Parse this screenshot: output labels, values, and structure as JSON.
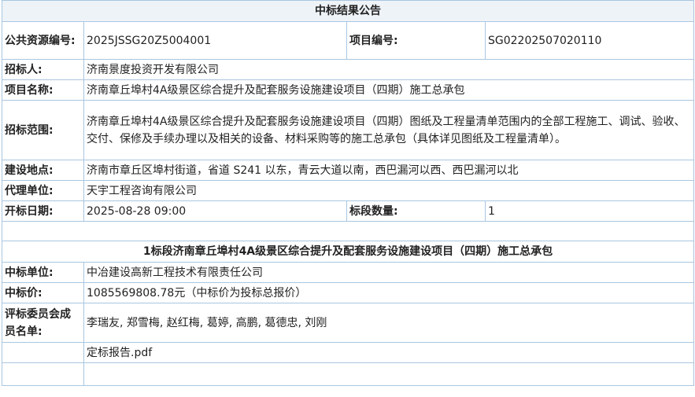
{
  "title": "中标结果公告",
  "rows": {
    "resource_no_label": "公共资源编号:",
    "resource_no_value": "2025JSSG20Z5004001",
    "project_no_label": "项目编号:",
    "project_no_value": "SG02202507020110",
    "tenderer_label": "招标人:",
    "tenderer_value": "济南景度投资开发有限公司",
    "project_name_label": "项目名称:",
    "project_name_value": "济南章丘埠村4A级景区综合提升及配套服务设施建设项目（四期）施工总承包",
    "scope_label": "招标范围:",
    "scope_value": "济南章丘埠村4A级景区综合提升及配套服务设施建设项目（四期）图纸及工程量清单范围内的全部工程施工、调试、验收、交付、保修及手续办理以及相关的设备、材料采购等的施工总承包（具体详见图纸及工程量清单）。",
    "location_label": "建设地点:",
    "location_value": "济南市章丘区埠村街道，省道 S241 以东，青云大道以南，西巴漏河以西、西巴漏河以北",
    "agency_label": "代理单位:",
    "agency_value": "天宇工程咨询有限公司",
    "open_date_label": "开标日期:",
    "open_date_value": "2025-08-28 09:00",
    "section_count_label": "标段数量:",
    "section_count_value": "1"
  },
  "section": {
    "heading": "1标段济南章丘埠村4A级景区综合提升及配套服务设施建设项目（四期）施工总承包",
    "winner_label": "中标单位:",
    "winner_value": "中冶建设高新工程技术有限责任公司",
    "price_label": "中标价:",
    "price_value": "1085569808.78元（中标价为投标总报价）",
    "committee_label": "评标委员会成员名单:",
    "committee_value": "李瑞友, 郑雪梅, 赵红梅, 葛婷, 高鹏, 葛德忠, 刘刚",
    "attachment": "定标报告.pdf"
  }
}
